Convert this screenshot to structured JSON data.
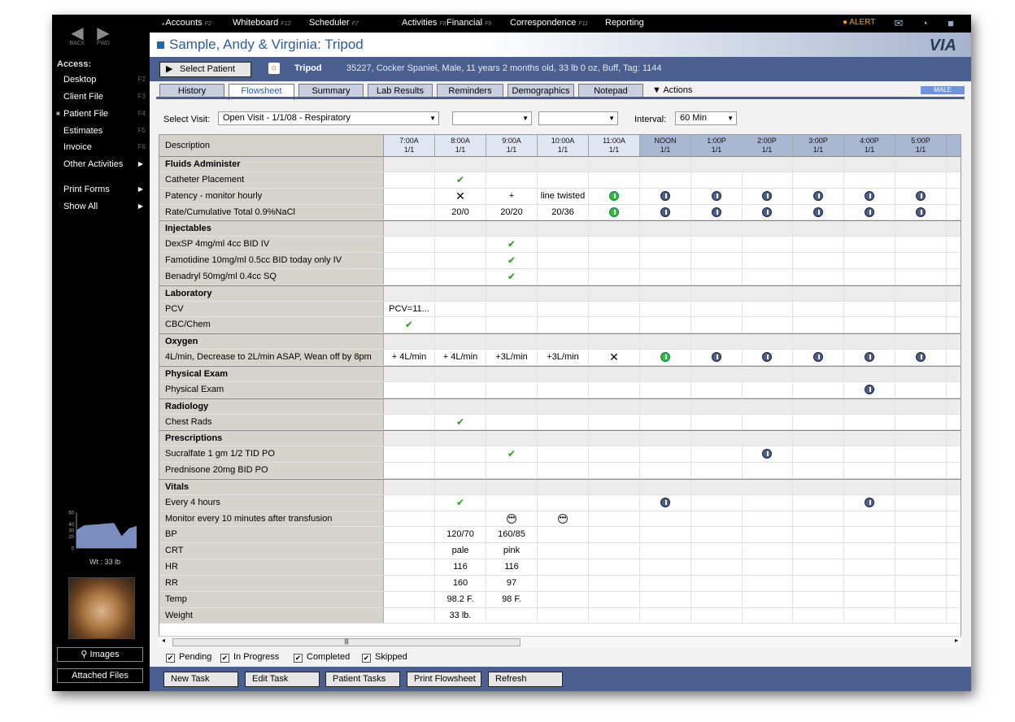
{
  "nav": {
    "back": "BACK",
    "fwd": "FWD"
  },
  "sidebar": {
    "access_label": "Access:",
    "items": [
      {
        "label": "Desktop",
        "key": "F2"
      },
      {
        "label": "Client File",
        "key": "F3"
      },
      {
        "label": "Patient File",
        "key": "F4"
      },
      {
        "label": "Estimates",
        "key": "F5"
      },
      {
        "label": "Invoice",
        "key": "F6"
      },
      {
        "label": "Other Activities",
        "key": ""
      },
      {
        "label": "Print Forms",
        "key": ""
      },
      {
        "label": "Show All",
        "key": ""
      }
    ],
    "weight_chart": {
      "ticks": [
        "60",
        "40",
        "30",
        "20",
        "0"
      ],
      "values": [
        30,
        38,
        39,
        40,
        41,
        42,
        20,
        33,
        37
      ],
      "ylim": [
        0,
        60
      ]
    },
    "weight_label": "Wt : 33 lb",
    "images_btn": "Images",
    "attached_btn": "Attached Files"
  },
  "topmenu": [
    {
      "label": "Accounts",
      "key": "F2"
    },
    {
      "label": "Whiteboard",
      "key": "F12"
    },
    {
      "label": "Scheduler",
      "key": "F7"
    },
    {
      "label": "Activities",
      "key": "F8"
    },
    {
      "label": "Financial",
      "key": "F9"
    },
    {
      "label": "Correspondence",
      "key": "F11"
    },
    {
      "label": "Reporting",
      "key": ""
    }
  ],
  "alert": "ALERT",
  "title": "Sample, Andy & Virginia:  Tripod",
  "logo": "VIA",
  "patient": {
    "select_btn": "Select Patient",
    "name": "Tripod",
    "info": "35227,  Cocker Spaniel,  Male,  11 years 2 months old,  33 lb 0 oz,  Buff,  Tag: 1144"
  },
  "tabs": [
    "History",
    "Flowsheet",
    "Summary",
    "Lab Results",
    "Reminders",
    "Demographics",
    "Notepad"
  ],
  "actions": "Actions",
  "sex_badge": "MALE",
  "visit": {
    "label": "Select Visit:",
    "value": "Open Visit - 1/1/08  -  Respiratory",
    "interval_label": "Interval:",
    "interval_value": "60 Min"
  },
  "grid": {
    "desc_header": "Description",
    "columns": [
      {
        "t": "7:00A",
        "d": "1/1"
      },
      {
        "t": "8:00A",
        "d": "1/1"
      },
      {
        "t": "9:00A",
        "d": "1/1"
      },
      {
        "t": "10:00A",
        "d": "1/1"
      },
      {
        "t": "11:00A",
        "d": "1/1"
      },
      {
        "t": "NOON",
        "d": "1/1"
      },
      {
        "t": "1:00P",
        "d": "1/1"
      },
      {
        "t": "2:00P",
        "d": "1/1"
      },
      {
        "t": "3:00P",
        "d": "1/1"
      },
      {
        "t": "4:00P",
        "d": "1/1"
      },
      {
        "t": "5:00P",
        "d": "1/1"
      }
    ],
    "rows": [
      {
        "sec": true,
        "d": "Fluids Administer",
        "c": []
      },
      {
        "d": "Catheter Placement",
        "c": [
          "",
          "ck"
        ]
      },
      {
        "d": "Patency - monitor hourly",
        "c": [
          "",
          "x",
          "+",
          "line twisted",
          "g",
          "b",
          "b",
          "b",
          "b",
          "b",
          "b"
        ]
      },
      {
        "d": "Rate/Cumulative Total  0.9%NaCl",
        "c": [
          "",
          "20/0",
          "20/20",
          "20/36",
          "g",
          "b",
          "b",
          "b",
          "b",
          "b",
          "b"
        ]
      },
      {
        "sec": true,
        "d": "Injectables",
        "c": []
      },
      {
        "d": "DexSP 4mg/ml  4cc BID IV",
        "c": [
          "",
          "",
          "ck"
        ]
      },
      {
        "d": "Famotidine 10mg/ml  0.5cc BID today only IV",
        "c": [
          "",
          "",
          "ck"
        ]
      },
      {
        "d": "Benadryl 50mg/ml 0.4cc SQ",
        "c": [
          "",
          "",
          "ck"
        ]
      },
      {
        "sec": true,
        "d": "Laboratory",
        "c": []
      },
      {
        "d": "PCV",
        "c": [
          "PCV=11..."
        ]
      },
      {
        "d": "CBC/Chem",
        "c": [
          "ck"
        ]
      },
      {
        "sec": true,
        "d": "Oxygen",
        "c": []
      },
      {
        "d": "4L/min, Decrease to 2L/min ASAP, Wean off by 8pm",
        "c": [
          "+ 4L/min",
          "+ 4L/min",
          "+3L/min",
          "+3L/min",
          "x",
          "g",
          "b",
          "b",
          "b",
          "b",
          "b"
        ]
      },
      {
        "sec": true,
        "d": "Physical Exam",
        "c": []
      },
      {
        "d": "Physical Exam",
        "c": [
          "",
          "",
          "",
          "",
          "",
          "",
          "",
          "",
          "",
          "b"
        ]
      },
      {
        "sec": true,
        "d": "Radiology",
        "c": []
      },
      {
        "d": "Chest Rads",
        "c": [
          "",
          "ck"
        ]
      },
      {
        "sec": true,
        "d": "Prescriptions",
        "c": []
      },
      {
        "d": "Sucralfate  1 gm 1/2 TID PO",
        "c": [
          "",
          "",
          "ck",
          "",
          "",
          "",
          "",
          "b"
        ]
      },
      {
        "d": "Prednisone 20mg BID PO",
        "c": []
      },
      {
        "sec": true,
        "d": "Vitals",
        "c": []
      },
      {
        "d": "Every 4 hours",
        "c": [
          "",
          "ck",
          "",
          "",
          "",
          "b",
          "",
          "",
          "",
          "b"
        ]
      },
      {
        "d": "Monitor every 10 minutes after transfusion",
        "c": [
          "",
          "",
          "dots",
          "dots"
        ]
      },
      {
        "d": "BP",
        "c": [
          "",
          "120/70",
          "160/85"
        ]
      },
      {
        "d": "CRT",
        "c": [
          "",
          "pale",
          "pink"
        ]
      },
      {
        "d": "HR",
        "c": [
          "",
          "116",
          "116"
        ]
      },
      {
        "d": "RR",
        "c": [
          "",
          "160",
          "97"
        ]
      },
      {
        "d": "Temp",
        "c": [
          "",
          "98.2 F.",
          "98 F."
        ]
      },
      {
        "d": "Weight",
        "c": [
          "",
          "33 lb."
        ]
      }
    ]
  },
  "legend": [
    "Pending",
    "In Progress",
    "Completed",
    "Skipped"
  ],
  "buttons": [
    "New Task",
    "Edit Task",
    "Patient Tasks",
    "Print Flowsheet",
    "Refresh"
  ],
  "colors": {
    "accent": "#4a5f8f",
    "check": "#2a9a18",
    "pending_clock": "#4a5f8f",
    "due_clock": "#2dc22d"
  }
}
